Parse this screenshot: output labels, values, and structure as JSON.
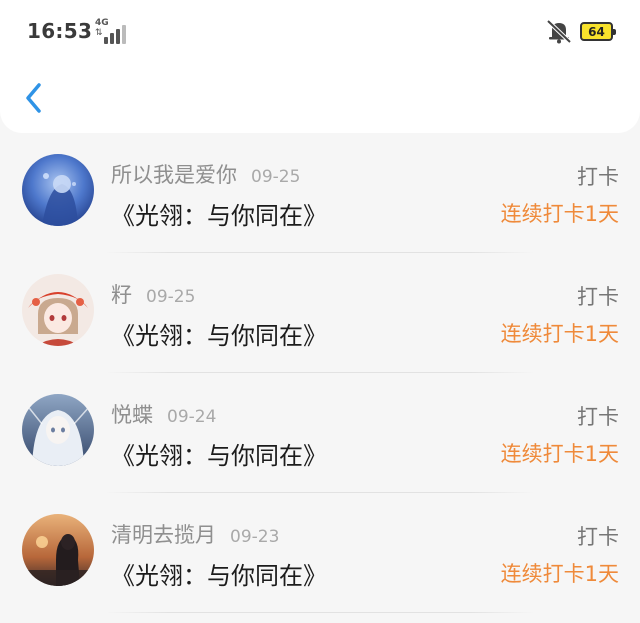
{
  "status_bar": {
    "time": "16:53",
    "network": "4G",
    "battery": "64"
  },
  "colors": {
    "accent_blue": "#2f93e6",
    "streak_orange": "#ef8a3a",
    "battery_yellow": "#f8e22c"
  },
  "nav": {
    "back_icon": "chevron-left-icon"
  },
  "entries": [
    {
      "user": "所以我是爱你",
      "date": "09-25",
      "title": "《光翎：与你同在》",
      "action": "打卡",
      "streak": "连续打卡1天"
    },
    {
      "user": "籽",
      "date": "09-25",
      "title": "《光翎：与你同在》",
      "action": "打卡",
      "streak": "连续打卡1天"
    },
    {
      "user": "悦蝶",
      "date": "09-24",
      "title": "《光翎：与你同在》",
      "action": "打卡",
      "streak": "连续打卡1天"
    },
    {
      "user": "清明去揽月",
      "date": "09-23",
      "title": "《光翎：与你同在》",
      "action": "打卡",
      "streak": "连续打卡1天"
    }
  ]
}
